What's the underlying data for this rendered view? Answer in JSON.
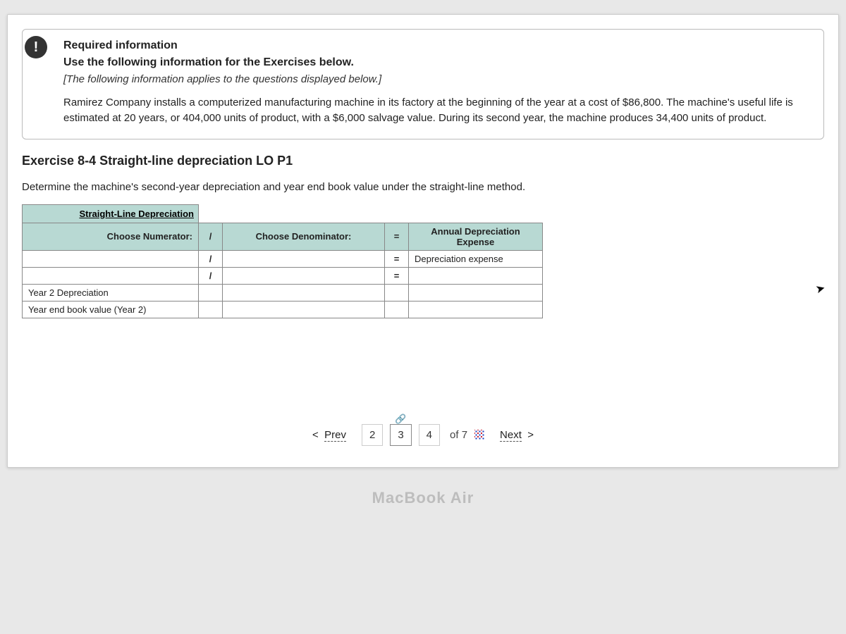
{
  "info_badge": "!",
  "required": {
    "title": "Required information",
    "use_line": "Use the following information for the Exercises below.",
    "applies_line": "[The following information applies to the questions displayed below.]",
    "paragraph": "Ramirez Company installs a computerized manufacturing machine in its factory at the beginning of the year at a cost of $86,800. The machine's useful life is estimated at 20 years, or 404,000 units of product, with a $6,000 salvage value. During its second year, the machine produces 34,400 units of product."
  },
  "exercise_title": "Exercise 8-4 Straight-line depreciation LO P1",
  "instruction": "Determine the machine's second-year depreciation and year end book value under the straight-line method.",
  "table": {
    "top_header": "Straight-Line Depreciation",
    "col_numerator": "Choose Numerator:",
    "col_denominator": "Choose Denominator:",
    "col_expense": "Annual Depreciation Expense",
    "slash": "/",
    "equals": "=",
    "expense_label": "Depreciation expense",
    "row_year2": "Year 2 Depreciation",
    "row_bookvalue": "Year end book value (Year 2)"
  },
  "pager": {
    "prev": "Prev",
    "next": "Next",
    "nums": [
      "2",
      "3",
      "4"
    ],
    "current": "3",
    "of_label": "of",
    "total": "7"
  },
  "device_label": "MacBook Air"
}
